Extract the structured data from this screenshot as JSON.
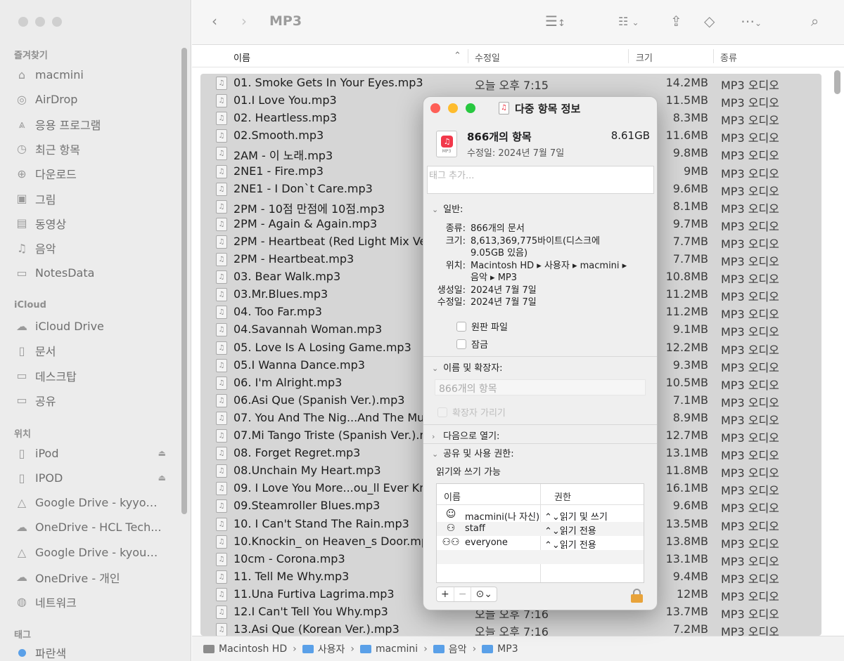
{
  "sidebar": {
    "favorites_title": "즐겨찾기",
    "favorites": [
      {
        "label": "macmini",
        "icon": "home-icon"
      },
      {
        "label": "AirDrop",
        "icon": "airdrop-icon"
      },
      {
        "label": "응용 프로그램",
        "icon": "applications-icon"
      },
      {
        "label": "최근 항목",
        "icon": "clock-icon"
      },
      {
        "label": "다운로드",
        "icon": "download-icon"
      },
      {
        "label": "그림",
        "icon": "pictures-icon"
      },
      {
        "label": "동영상",
        "icon": "movies-icon"
      },
      {
        "label": "음악",
        "icon": "music-icon"
      },
      {
        "label": "NotesData",
        "icon": "folder-icon"
      }
    ],
    "icloud_title": "iCloud",
    "icloud": [
      {
        "label": "iCloud Drive",
        "icon": "cloud-icon"
      },
      {
        "label": "문서",
        "icon": "document-icon"
      },
      {
        "label": "데스크탑",
        "icon": "desktop-icon"
      },
      {
        "label": "공유",
        "icon": "shared-folder-icon"
      }
    ],
    "locations_title": "위치",
    "locations": [
      {
        "label": "iPod",
        "icon": "drive-icon",
        "eject": true
      },
      {
        "label": "IPOD",
        "icon": "drive-icon",
        "eject": true
      },
      {
        "label": "Google Drive - kyyou...",
        "icon": "google-drive-icon"
      },
      {
        "label": "OneDrive - HCL Tech...",
        "icon": "onedrive-icon"
      },
      {
        "label": "Google Drive - kyoun...",
        "icon": "google-drive-icon"
      },
      {
        "label": "OneDrive - 개인",
        "icon": "onedrive-icon"
      },
      {
        "label": "네트워크",
        "icon": "network-icon"
      }
    ],
    "tags_title": "태그",
    "tags": [
      {
        "label": "파란색",
        "color": "#5aa0e8"
      }
    ]
  },
  "toolbar": {
    "title": "MP3"
  },
  "columns": {
    "name": "이름",
    "modified": "수정일",
    "size": "크기",
    "kind": "종류"
  },
  "files": [
    {
      "name": "01. Smoke Gets In Your Eyes.mp3",
      "date": "오늘 오후 7:15",
      "size": "14.2MB",
      "kind": "MP3 오디오"
    },
    {
      "name": "01.I Love You.mp3",
      "date": "",
      "size": "11.5MB",
      "kind": "MP3 오디오"
    },
    {
      "name": "02. Heartless.mp3",
      "date": "",
      "size": "8.3MB",
      "kind": "MP3 오디오"
    },
    {
      "name": "02.Smooth.mp3",
      "date": "",
      "size": "11.6MB",
      "kind": "MP3 오디오"
    },
    {
      "name": "2AM - 이 노래.mp3",
      "date": "",
      "size": "9.8MB",
      "kind": "MP3 오디오"
    },
    {
      "name": "2NE1 - Fire.mp3",
      "date": "",
      "size": "9MB",
      "kind": "MP3 오디오"
    },
    {
      "name": "2NE1 - I Don`t Care.mp3",
      "date": "",
      "size": "9.6MB",
      "kind": "MP3 오디오"
    },
    {
      "name": "2PM - 10점 만점에 10점.mp3",
      "date": "",
      "size": "8.1MB",
      "kind": "MP3 오디오"
    },
    {
      "name": "2PM - Again & Again.mp3",
      "date": "",
      "size": "9.7MB",
      "kind": "MP3 오디오"
    },
    {
      "name": "2PM - Heartbeat (Red Light Mix Ver",
      "date": "",
      "size": "7.7MB",
      "kind": "MP3 오디오"
    },
    {
      "name": "2PM - Heartbeat.mp3",
      "date": "",
      "size": "7.7MB",
      "kind": "MP3 오디오"
    },
    {
      "name": "03. Bear Walk.mp3",
      "date": "",
      "size": "10.8MB",
      "kind": "MP3 오디오"
    },
    {
      "name": "03.Mr.Blues.mp3",
      "date": "",
      "size": "11.2MB",
      "kind": "MP3 오디오"
    },
    {
      "name": "04. Too Far.mp3",
      "date": "",
      "size": "11.2MB",
      "kind": "MP3 오디오"
    },
    {
      "name": "04.Savannah Woman.mp3",
      "date": "",
      "size": "9.1MB",
      "kind": "MP3 오디오"
    },
    {
      "name": "05. Love Is A Losing Game.mp3",
      "date": "",
      "size": "12.2MB",
      "kind": "MP3 오디오"
    },
    {
      "name": "05.I Wanna Dance.mp3",
      "date": "",
      "size": "9.3MB",
      "kind": "MP3 오디오"
    },
    {
      "name": "06. I'm Alright.mp3",
      "date": "",
      "size": "10.5MB",
      "kind": "MP3 오디오"
    },
    {
      "name": "06.Asi Que (Spanish Ver.).mp3",
      "date": "",
      "size": "7.1MB",
      "kind": "MP3 오디오"
    },
    {
      "name": "07. You And The Nig...And The Musi",
      "date": "",
      "size": "8.9MB",
      "kind": "MP3 오디오"
    },
    {
      "name": "07.Mi Tango Triste (Spanish Ver.).m",
      "date": "",
      "size": "12.7MB",
      "kind": "MP3 오디오"
    },
    {
      "name": "08. Forget Regret.mp3",
      "date": "",
      "size": "13.1MB",
      "kind": "MP3 오디오"
    },
    {
      "name": "08.Unchain My Heart.mp3",
      "date": "",
      "size": "11.8MB",
      "kind": "MP3 오디오"
    },
    {
      "name": "09. I Love You More...ou_ll Ever Kno",
      "date": "",
      "size": "16.1MB",
      "kind": "MP3 오디오"
    },
    {
      "name": "09.Steamroller Blues.mp3",
      "date": "",
      "size": "9.6MB",
      "kind": "MP3 오디오"
    },
    {
      "name": "10. I Can't Stand The Rain.mp3",
      "date": "",
      "size": "13.5MB",
      "kind": "MP3 오디오"
    },
    {
      "name": "10.Knockin_ on Heaven_s Door.mp3",
      "date": "",
      "size": "13.8MB",
      "kind": "MP3 오디오"
    },
    {
      "name": "10cm - Corona.mp3",
      "date": "",
      "size": "13.1MB",
      "kind": "MP3 오디오"
    },
    {
      "name": "11. Tell Me Why.mp3",
      "date": "",
      "size": "9.4MB",
      "kind": "MP3 오디오"
    },
    {
      "name": "11.Una Furtiva Lagrima.mp3",
      "date": "",
      "size": "12MB",
      "kind": "MP3 오디오"
    },
    {
      "name": "12.I Can't Tell You Why.mp3",
      "date": "오늘 오후 7:16",
      "size": "13.7MB",
      "kind": "MP3 오디오"
    },
    {
      "name": "13.Asi Que (Korean Ver.).mp3",
      "date": "오늘 오후 7:16",
      "size": "7.2MB",
      "kind": "MP3 오디오"
    }
  ],
  "pathbar": [
    {
      "label": "Macintosh HD",
      "icon": "hard-drive-icon"
    },
    {
      "label": "사용자",
      "icon": "folder-icon"
    },
    {
      "label": "macmini",
      "icon": "home-folder-icon"
    },
    {
      "label": "음악",
      "icon": "folder-icon"
    },
    {
      "label": "MP3",
      "icon": "folder-icon"
    }
  ],
  "info": {
    "title": "다중 항목 정보",
    "count": "866개의 항목",
    "total_size": "8.61GB",
    "modified_line": "수정일: 2024년 7월 7일",
    "tags_placeholder": "태그 추가...",
    "general_label": "일반:",
    "kind_key": "종류:",
    "kind_val": "866개의 문서",
    "size_key": "크기:",
    "size_val1": "8,613,369,775바이트(디스크에",
    "size_val2": "9.05GB 있음)",
    "where_key": "위치:",
    "where_val1": "Macintosh HD ▸ 사용자 ▸ macmini ▸",
    "where_val2": "음악 ▸ MP3",
    "created_key": "생성일:",
    "created_val": "2024년 7월 7일",
    "modified_key": "수정일:",
    "modified_val": "2024년 7월 7일",
    "stationery_label": "원판 파일",
    "locked_label": "잠금",
    "name_ext_label": "이름 및 확장자:",
    "name_field_placeholder": "866개의 항목",
    "hide_ext_label": "확장자 가리기",
    "open_with_label": "다음으로 열기:",
    "sharing_label": "공유 및 사용 권한:",
    "rw_status": "읽기와 쓰기 가능",
    "perm_headers": {
      "name": "이름",
      "priv": "권한"
    },
    "permissions": [
      {
        "name": "macmini(나 자신)",
        "priv": "⌃⌄읽기 및 쓰기",
        "icon": "user-icon"
      },
      {
        "name": "staff",
        "priv": "⌃⌄읽기 전용",
        "icon": "group-icon"
      },
      {
        "name": "everyone",
        "priv": "⌃⌄읽기 전용",
        "icon": "everyone-icon"
      }
    ],
    "add_btn": "+",
    "remove_btn": "−",
    "action_btn": "⊙⌄"
  }
}
